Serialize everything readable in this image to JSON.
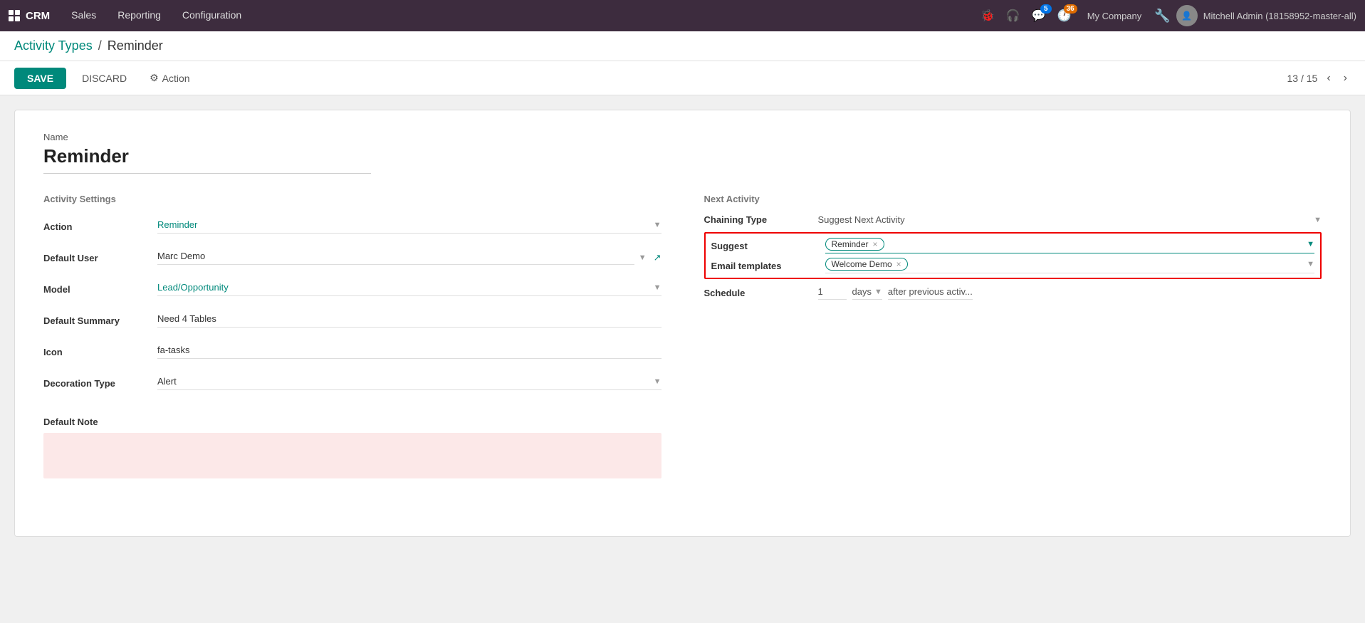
{
  "topnav": {
    "app_name": "CRM",
    "menu_items": [
      "Sales",
      "Reporting",
      "Configuration"
    ],
    "icons": {
      "bug": "🐞",
      "headset": "🎧",
      "chat": "💬",
      "chat_badge": "5",
      "clock": "🕐",
      "clock_badge": "36"
    },
    "company": "My Company",
    "user": "Mitchell Admin (18158952-master-all)"
  },
  "breadcrumb": {
    "parent": "Activity Types",
    "separator": "/",
    "current": "Reminder"
  },
  "toolbar": {
    "save_label": "SAVE",
    "discard_label": "DISCARD",
    "action_label": "Action",
    "pager": "13 / 15"
  },
  "form": {
    "name_label": "Name",
    "name_value": "Reminder",
    "activity_settings_title": "Activity Settings",
    "fields": [
      {
        "label": "Action",
        "value": "Reminder",
        "type": "select",
        "teal": true
      },
      {
        "label": "Default User",
        "value": "Marc Demo",
        "type": "user",
        "teal": false
      },
      {
        "label": "Model",
        "value": "Lead/Opportunity",
        "type": "select",
        "teal": true
      },
      {
        "label": "Default Summary",
        "value": "Need 4 Tables",
        "type": "text"
      },
      {
        "label": "Icon",
        "value": "fa-tasks",
        "type": "text"
      },
      {
        "label": "Decoration Type",
        "value": "Alert",
        "type": "select",
        "teal": false
      }
    ],
    "default_note_label": "Default Note",
    "next_activity_title": "Next Activity",
    "chaining_type_label": "Chaining Type",
    "chaining_type_value": "Suggest Next Activity",
    "suggest_label": "Suggest",
    "suggest_tag": "Reminder",
    "email_templates_label": "Email templates",
    "email_templates_tag": "Welcome Demo",
    "schedule_label": "Schedule",
    "schedule_num": "1",
    "schedule_unit": "days",
    "schedule_after": "after previous activ..."
  }
}
